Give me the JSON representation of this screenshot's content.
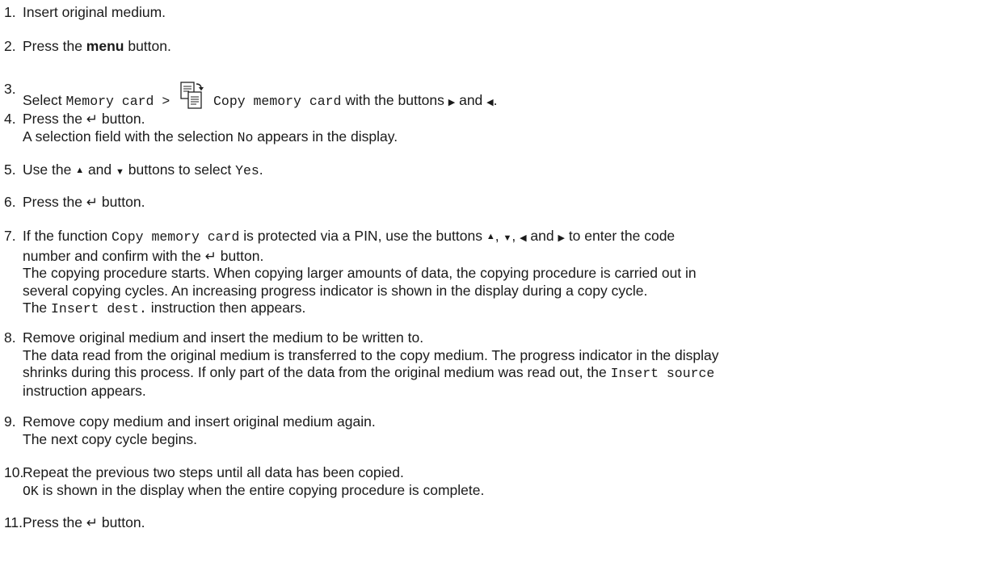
{
  "steps": [
    {
      "num": "1.",
      "segs": [
        {
          "t": "Insert original medium."
        }
      ]
    },
    {
      "num": "2.",
      "segs": [
        {
          "t": "Press the "
        },
        {
          "t": "menu",
          "s": "bold"
        },
        {
          "t": " button."
        }
      ]
    },
    {
      "num": "3.",
      "segs": [
        {
          "t": "Select "
        },
        {
          "t": "Memory card > ",
          "s": "mono"
        },
        {
          "icon": "copy-memory-card"
        },
        {
          "t": " Copy memory card",
          "s": "mono"
        },
        {
          "t": " with the buttons "
        },
        {
          "icon": "right-arrow"
        },
        {
          "t": " and "
        },
        {
          "icon": "left-arrow"
        },
        {
          "t": "."
        }
      ]
    },
    {
      "num": "4.",
      "segs": [
        {
          "t": "Press the "
        },
        {
          "icon": "enter-arrow"
        },
        {
          "t": "  button."
        },
        {
          "br": true
        },
        {
          "t": "A selection field with the selection "
        },
        {
          "t": "No",
          "s": "mono"
        },
        {
          "t": " appears in the display."
        }
      ]
    },
    {
      "num": "5.",
      "segs": [
        {
          "t": "Use the "
        },
        {
          "icon": "up-arrow"
        },
        {
          "t": " and "
        },
        {
          "icon": "down-arrow"
        },
        {
          "t": " buttons to select "
        },
        {
          "t": "Yes",
          "s": "mono"
        },
        {
          "t": "."
        }
      ]
    },
    {
      "num": "6.",
      "segs": [
        {
          "t": "Press the "
        },
        {
          "icon": "enter-arrow"
        },
        {
          "t": "  button."
        }
      ]
    },
    {
      "num": "7.",
      "segs": [
        {
          "t": "If the function "
        },
        {
          "t": "Copy memory card",
          "s": "mono"
        },
        {
          "t": " is protected via a PIN, use the buttons "
        },
        {
          "icon": "up-arrow"
        },
        {
          "t": ", "
        },
        {
          "icon": "down-arrow"
        },
        {
          "t": ", "
        },
        {
          "icon": "left-arrow"
        },
        {
          "t": " and "
        },
        {
          "icon": "right-arrow"
        },
        {
          "t": " to enter the code"
        },
        {
          "br": true
        },
        {
          "t": "number and confirm with the "
        },
        {
          "icon": "enter-arrow"
        },
        {
          "t": "  button."
        },
        {
          "br": true
        },
        {
          "t": "The copying procedure starts. When copying larger amounts of data, the copying procedure is carried out in"
        },
        {
          "br": true
        },
        {
          "t": "several copying cycles. An increasing progress indicator is shown in the display during a copy cycle."
        },
        {
          "br": true
        },
        {
          "t": "The "
        },
        {
          "t": "Insert dest.",
          "s": "mono"
        },
        {
          "t": " instruction then appears."
        }
      ]
    },
    {
      "num": "8.",
      "segs": [
        {
          "t": "Remove original medium and insert the medium to be written to."
        },
        {
          "br": true
        },
        {
          "t": "The data read from the original medium is transferred to the copy medium. The progress indicator in the display"
        },
        {
          "br": true
        },
        {
          "t": "shrinks during this process. If only part of the data from the original medium was read out, the "
        },
        {
          "t": "Insert source",
          "s": "mono"
        },
        {
          "br": true
        },
        {
          "t": "instruction appears."
        }
      ]
    },
    {
      "num": "9.",
      "segs": [
        {
          "t": "Remove copy medium and insert original medium again."
        },
        {
          "br": true
        },
        {
          "t": "The next copy cycle begins."
        }
      ]
    },
    {
      "num": "10.",
      "segs": [
        {
          "t": "Repeat the previous two steps until all data has been copied."
        },
        {
          "br": true
        },
        {
          "t": "OK",
          "s": "mono"
        },
        {
          "t": " is shown in the display when the entire copying procedure is complete."
        }
      ]
    },
    {
      "num": "11.",
      "segs": [
        {
          "t": "Press the "
        },
        {
          "icon": "enter-arrow"
        },
        {
          "t": "  button."
        }
      ]
    }
  ]
}
